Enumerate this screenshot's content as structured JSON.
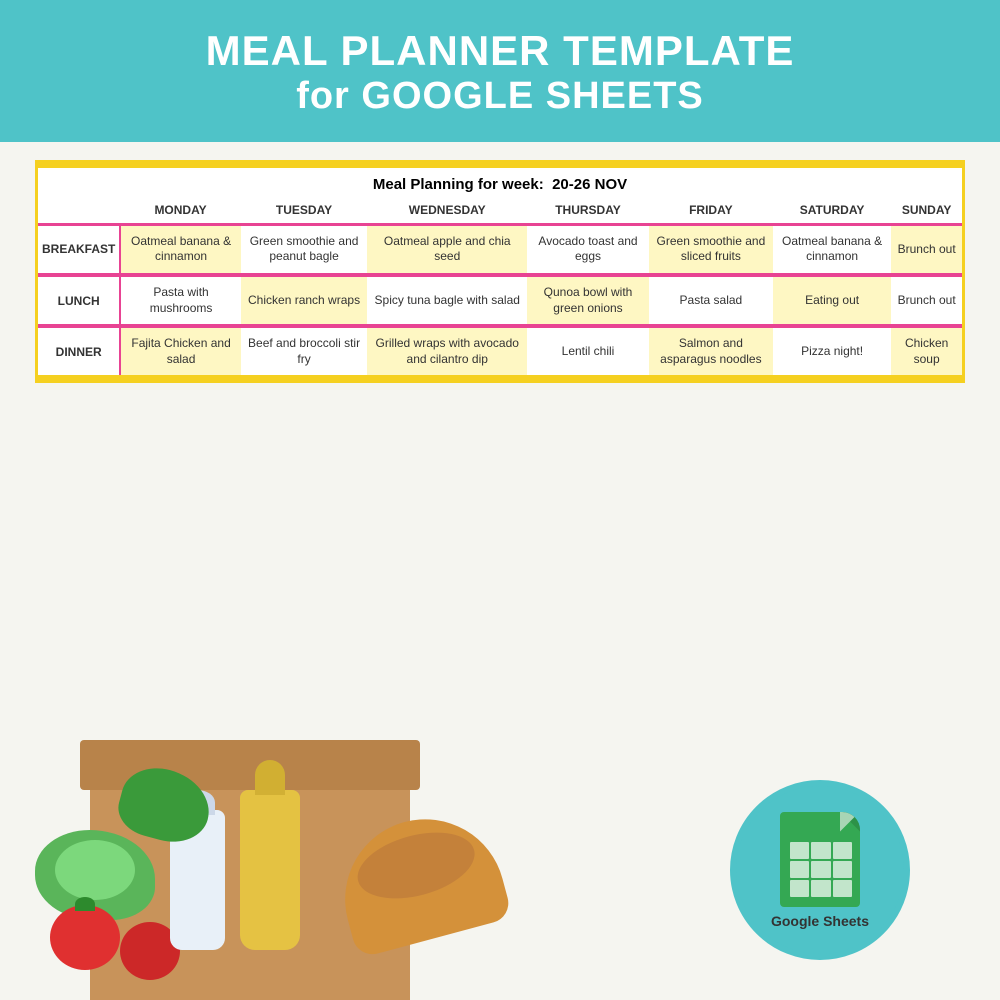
{
  "banner": {
    "line1": "MEAL PLANNER TEMPLATE",
    "line2": "for GOOGLE SHEETS"
  },
  "planner": {
    "week_label": "Meal Planning for week:",
    "week_range": "20-26 NOV",
    "days": [
      "MONDAY",
      "TUESDAY",
      "WEDNESDAY",
      "THURSDAY",
      "FRIDAY",
      "SATURDAY",
      "SUNDAY"
    ],
    "meals": [
      {
        "label": "BREAKFAST",
        "items": [
          "Oatmeal banana & cinnamon",
          "Green smoothie and peanut bagle",
          "Oatmeal apple and chia seed",
          "Avocado toast and eggs",
          "Green smoothie and sliced fruits",
          "Oatmeal banana & cinnamon",
          "Brunch out"
        ]
      },
      {
        "label": "LUNCH",
        "items": [
          "Pasta with mushrooms",
          "Chicken ranch wraps",
          "Spicy tuna bagle with salad",
          "Qunoa bowl with green onions",
          "Pasta salad",
          "Eating out",
          "Brunch out"
        ]
      },
      {
        "label": "DINNER",
        "items": [
          "Fajita Chicken and salad",
          "Beef and broccoli stir fry",
          "Grilled wraps with avocado and cilantro dip",
          "Lentil chili",
          "Salmon and asparagus noodles",
          "Pizza night!",
          "Chicken soup"
        ]
      }
    ]
  },
  "google_sheets": {
    "label": "Google Sheets"
  }
}
